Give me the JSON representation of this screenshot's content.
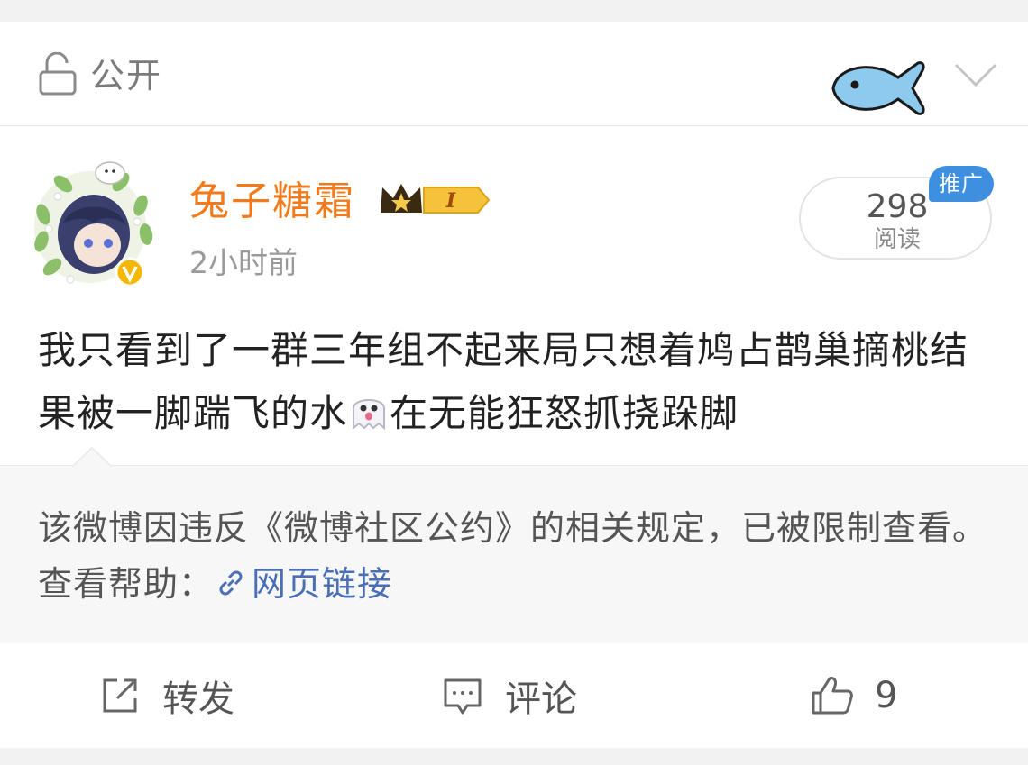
{
  "header": {
    "visibility_label": "公开"
  },
  "author": {
    "name": "兔子糖霜",
    "timestamp": "2小时前",
    "level_badge": "I"
  },
  "stats": {
    "read_count": "298",
    "read_label": "阅读",
    "promo_label": "推广"
  },
  "post": {
    "text_before": "我只看到了一群三年组不起来局只想着鸠占鹊巢摘桃结果被一脚踹飞的水",
    "text_after": "在无能狂怒抓挠跺脚"
  },
  "notice": {
    "text": "该微博因违反《微博社区公约》的相关规定，已被限制查看。查看帮助：",
    "link_label": "网页链接"
  },
  "actions": {
    "repost_label": "转发",
    "comment_label": "评论",
    "like_count": "9"
  },
  "colors": {
    "username": "#f27a1a",
    "link": "#4a6fb5",
    "promo": "#3f8fe0",
    "fish": "#8ec9ee"
  }
}
